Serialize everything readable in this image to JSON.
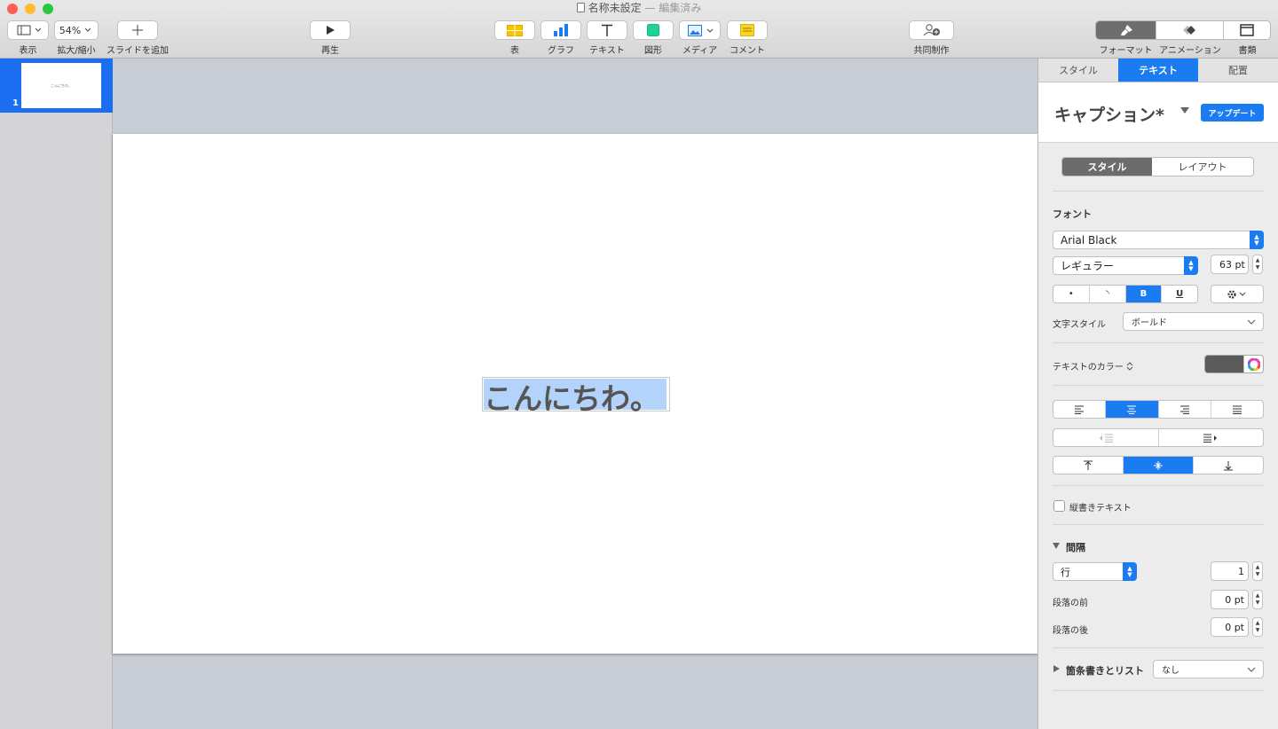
{
  "window": {
    "title": "名称未設定",
    "title_status": "— 編集済み",
    "traffic_colors": [
      "#fe5f57",
      "#febc2e",
      "#28c840"
    ]
  },
  "toolbar": {
    "view_label": "表示",
    "zoom_value": "54%",
    "zoom_label": "拡大/縮小",
    "add_slide_label": "スライドを追加",
    "play_label": "再生",
    "table_label": "表",
    "chart_label": "グラフ",
    "text_label": "テキスト",
    "shape_label": "図形",
    "media_label": "メディア",
    "comment_label": "コメント",
    "collaborate_label": "共同制作",
    "format_label": "フォーマット",
    "animate_label": "アニメーション",
    "document_label": "書類"
  },
  "slides": {
    "selected_number": "1",
    "thumb_text": "こんにちわ。"
  },
  "slide": {
    "text": "こんにちわ。"
  },
  "inspector": {
    "tabs": [
      "スタイル",
      "テキスト",
      "配置"
    ],
    "active_tab": "テキスト",
    "paragraph_style": "キャプション*",
    "update_label": "アップデート",
    "subtabs": [
      "スタイル",
      "レイアウト"
    ],
    "font_heading": "フォント",
    "font_name": "Arial Black",
    "font_typeface": "レギュラー",
    "font_size": "63 pt",
    "format_buttons": [
      "•",
      "◝",
      "B",
      "U"
    ],
    "char_style_label": "文字スタイル",
    "char_style_value": "ボールド",
    "text_color_label": "テキストのカラー",
    "text_color": "#5b5b5b",
    "vertical_text_label": "縦書きテキスト",
    "spacing_heading": "間隔",
    "spacing_mode": "行",
    "spacing_value": "1",
    "before_label": "段落の前",
    "before_value": "0 pt",
    "after_label": "段落の後",
    "after_value": "0 pt",
    "bullets_heading": "箇条書きとリスト",
    "bullets_value": "なし",
    "accent": "#1b7cf2"
  }
}
